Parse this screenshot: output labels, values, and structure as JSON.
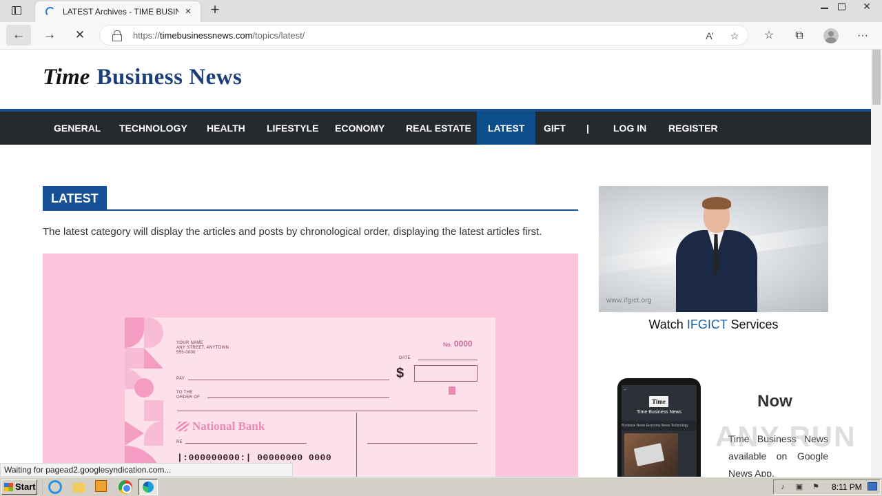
{
  "browser": {
    "tab_title": "LATEST Archives - TIME BUSINE",
    "tab_close": "×",
    "new_tab": "+",
    "url_prefix": "https://",
    "url_host": "timebusinessnews.com",
    "url_path": "/topics/latest/",
    "window_close": "✕",
    "read_aloud": "A’",
    "favorite_add": "☆",
    "favorites": "☆",
    "collections": "⧉",
    "more": "···"
  },
  "site": {
    "logo_part1": "Time",
    "logo_part2": "Business News",
    "nav": [
      "GENERAL",
      "TECHNOLOGY",
      "HEALTH",
      "LIFESTYLE",
      "ECONOMY",
      "REAL ESTATE",
      "LATEST",
      "GIFT",
      "|",
      "LOG IN",
      "REGISTER"
    ],
    "active_nav": "LATEST"
  },
  "category": {
    "title": "LATEST",
    "description": "The latest category will display the articles and posts by chronological order, displaying the latest articles first."
  },
  "check": {
    "name_line1": "YOUR NAME",
    "name_line2": "ANY STREET, ANYTOWN",
    "name_line3": "555-0000",
    "no_label": "No.",
    "no_value": "0000",
    "date_label": "DATE",
    "pay_label": "PAY",
    "dollar": "$",
    "to_label": "TO THE",
    "order_label": "ORDER OF",
    "bank": "National Bank",
    "re_label": "RE",
    "micr": "|:000000000:| 00000000 0000"
  },
  "sidebar": {
    "video_watermark": "www.ifgict.org",
    "caption_pre": "Watch ",
    "caption_highlight": "IFGICT",
    "caption_post": " Services",
    "phone_logo": "Time",
    "phone_title": "Time Business News",
    "phone_tabs": "Business News   Economy News   Technology",
    "now": "Now",
    "app_text": "Time Business News available on Google News App."
  },
  "watermark": "ANY RUN",
  "status": "Waiting for pagead2.googlesyndication.com...",
  "taskbar": {
    "start": "Start",
    "clock": "8:11 PM"
  }
}
